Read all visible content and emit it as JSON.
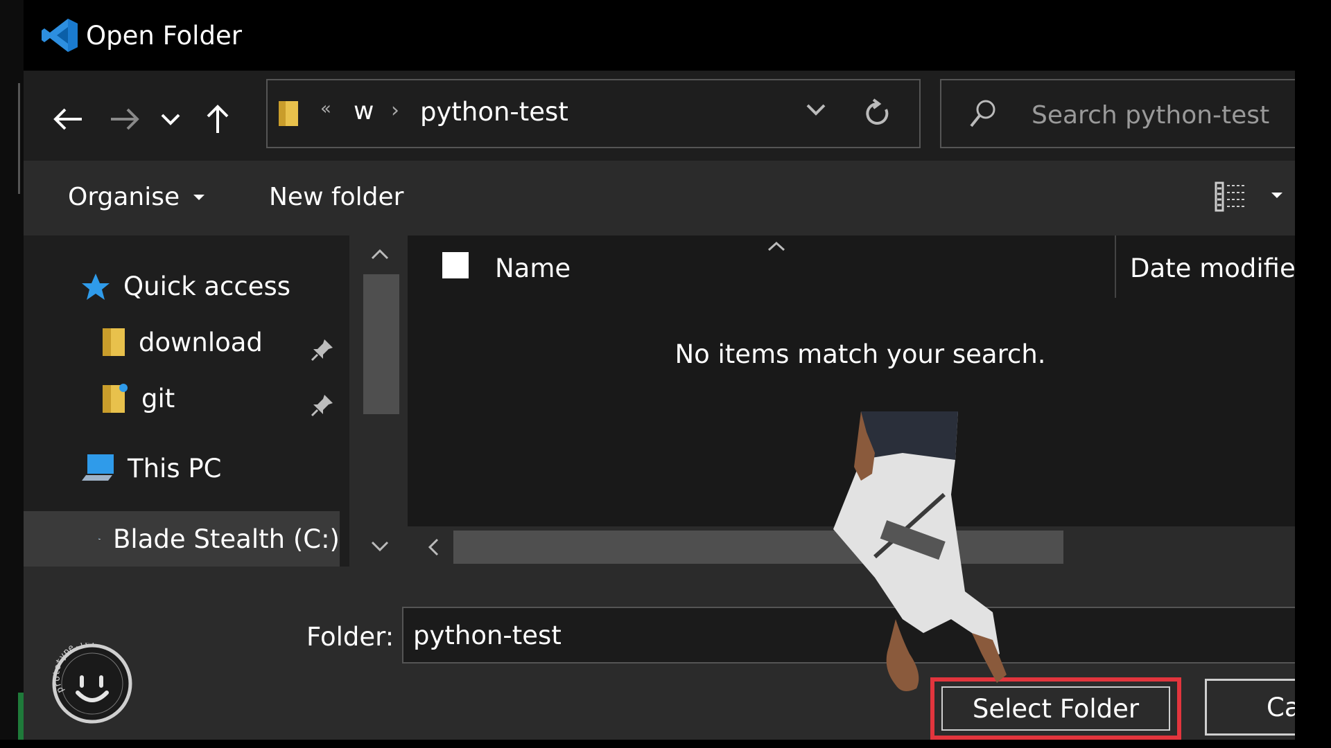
{
  "window": {
    "title": "Open Folder"
  },
  "address": {
    "overflow": "«",
    "parent": "w",
    "current": "python-test"
  },
  "search": {
    "placeholder": "Search python-test"
  },
  "toolbar": {
    "organise_label": "Organise",
    "new_folder_label": "New folder"
  },
  "nav_pane": {
    "items": [
      {
        "label": "Quick access",
        "icon": "star-icon"
      },
      {
        "label": "download",
        "icon": "folder-icon",
        "pinned": true
      },
      {
        "label": "git",
        "icon": "folder-icon",
        "pinned": true
      },
      {
        "label": "This PC",
        "icon": "computer-icon"
      },
      {
        "label": "Blade Stealth (C:)",
        "icon": "drive-icon",
        "selected": true
      }
    ]
  },
  "file_list": {
    "columns": [
      "Name",
      "Date modified"
    ],
    "empty_message": "No items match your search."
  },
  "footer": {
    "folder_label": "Folder:",
    "folder_value": "python-test",
    "select_label": "Select Folder",
    "cancel_label": "Cancel"
  },
  "watermark": {
    "text": "prototype.tel"
  },
  "colors": {
    "highlight": "#e2353d",
    "vscode_blue": "#2d8fe0",
    "folder_yellow": "#e8c14c"
  }
}
